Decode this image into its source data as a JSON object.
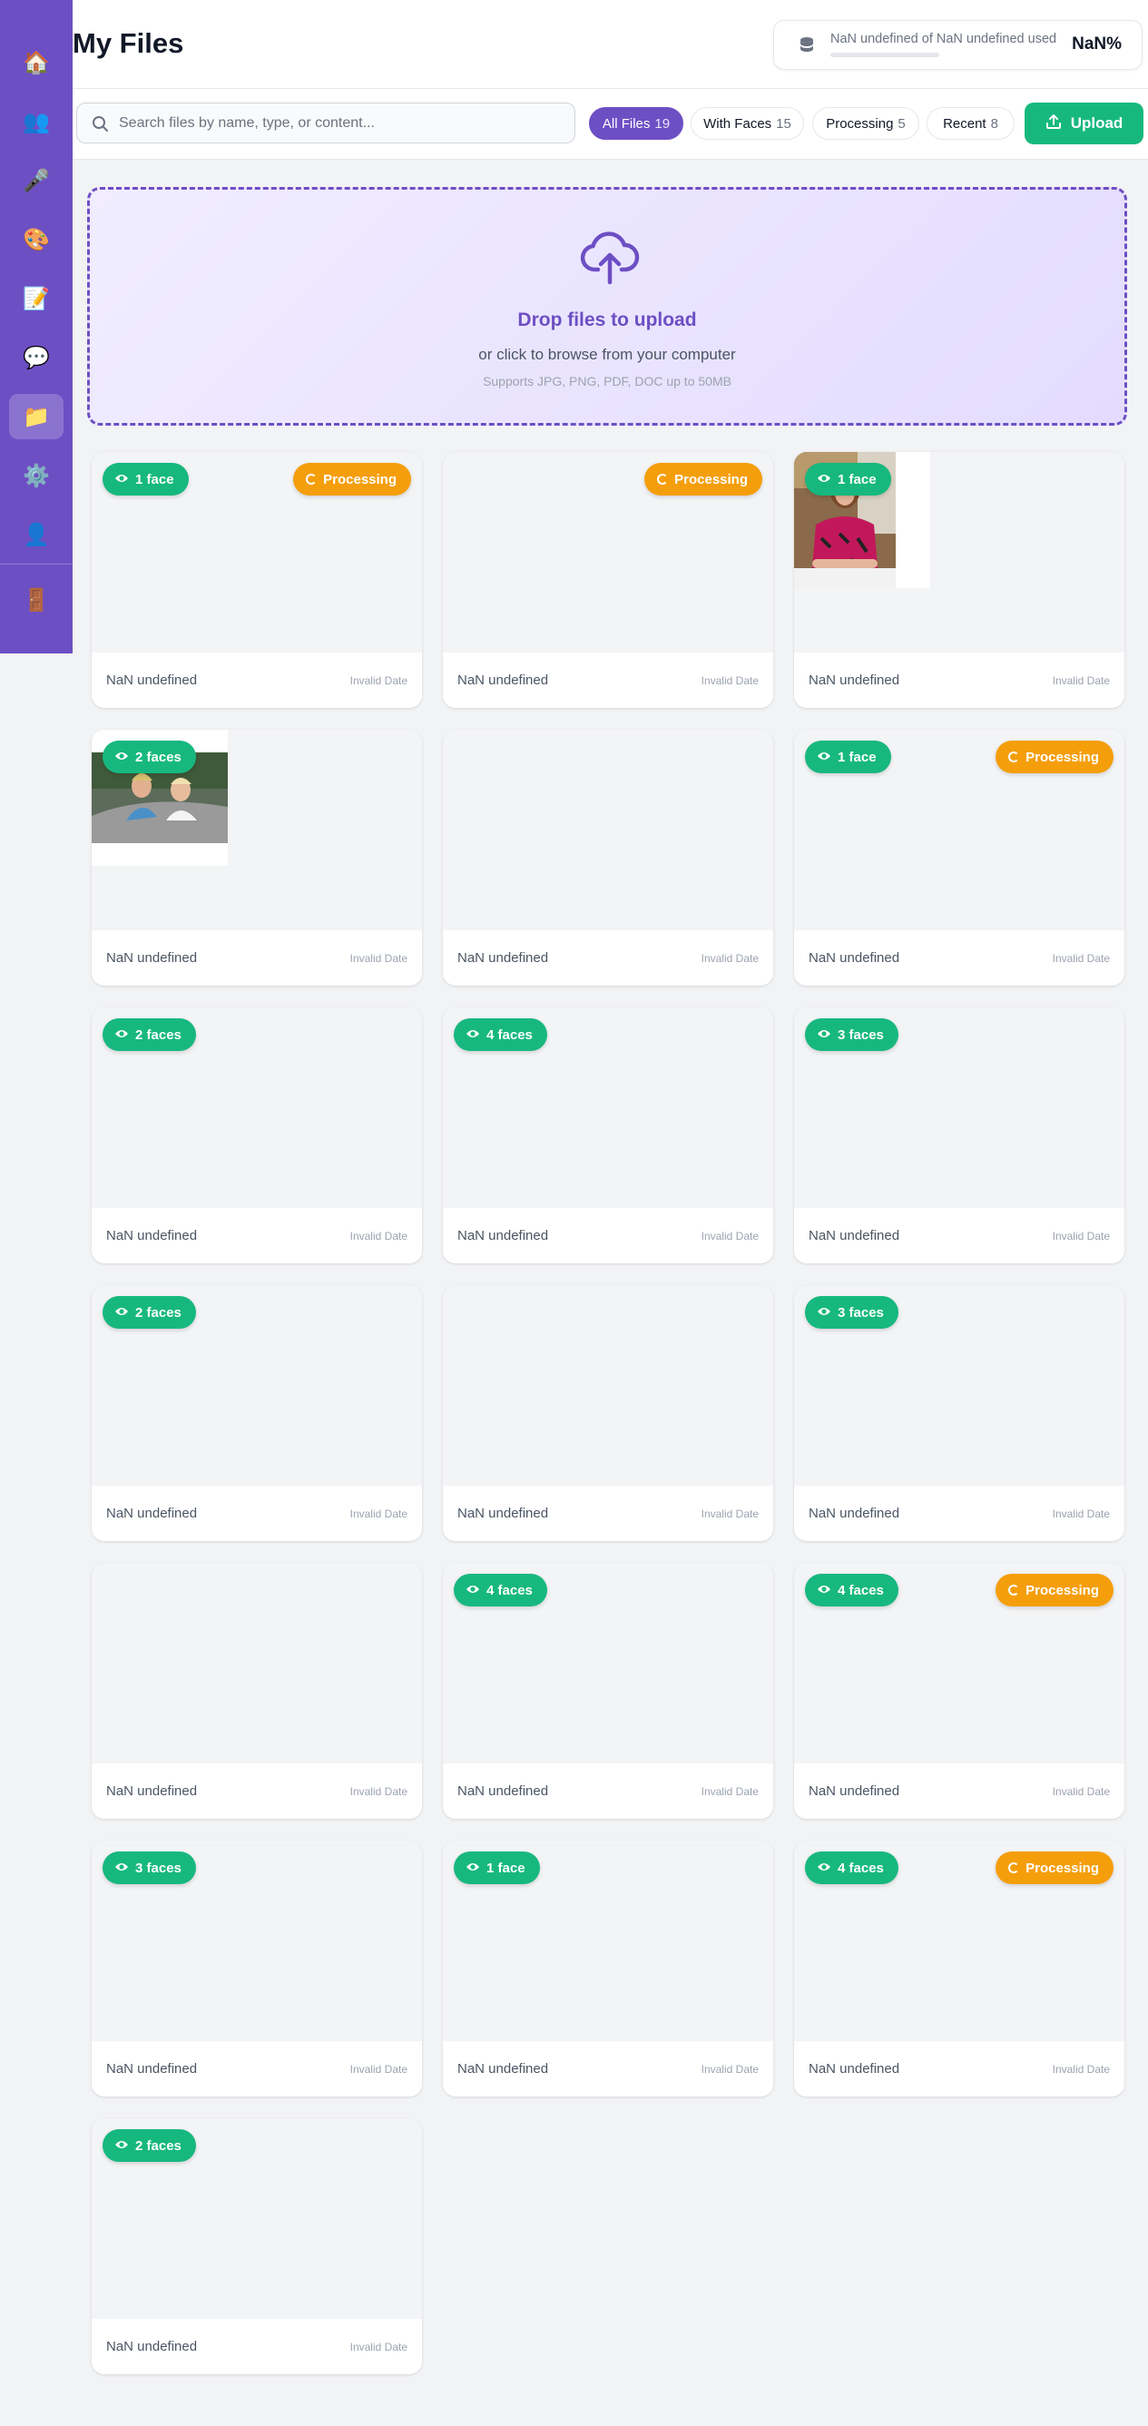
{
  "sidebar": {
    "items": [
      {
        "name": "home",
        "glyph": "🏠",
        "active": false
      },
      {
        "name": "people",
        "glyph": "👥",
        "active": false
      },
      {
        "name": "microphone",
        "glyph": "🎤",
        "active": false
      },
      {
        "name": "palette",
        "glyph": "🎨",
        "active": false
      },
      {
        "name": "notes",
        "glyph": "📝",
        "active": false
      },
      {
        "name": "chat",
        "glyph": "💬",
        "active": false
      },
      {
        "name": "files",
        "glyph": "📁",
        "active": true
      },
      {
        "name": "settings",
        "glyph": "⚙️",
        "active": false
      },
      {
        "name": "profile",
        "glyph": "👤",
        "active": false
      },
      {
        "name": "logout",
        "glyph": "🚪",
        "active": false
      }
    ]
  },
  "header": {
    "title": "My Files",
    "storage_text": "NaN undefined of NaN undefined used",
    "storage_percent": "NaN%"
  },
  "toolbar": {
    "search_placeholder": "Search files by name, type, or content...",
    "filters": [
      {
        "label": "All Files",
        "count": "19",
        "active": true
      },
      {
        "label": "With Faces",
        "count": "15",
        "active": false
      },
      {
        "label": "Processing",
        "count": "5",
        "active": false
      },
      {
        "label": "Recent",
        "count": "8",
        "active": false
      }
    ],
    "upload_label": "Upload"
  },
  "dropzone": {
    "title": "Drop files to upload",
    "subtitle": "or click to browse from your computer",
    "hint": "Supports JPG, PNG, PDF, DOC up to 50MB"
  },
  "colors": {
    "primary": "#6d4fc4",
    "success": "#17b87f",
    "warning": "#f59e0b"
  },
  "files": [
    {
      "faces": "1 face",
      "processing": true,
      "thumb": null,
      "size": "NaN undefined",
      "date": "Invalid Date"
    },
    {
      "faces": null,
      "processing": true,
      "thumb": null,
      "size": "NaN undefined",
      "date": "Invalid Date"
    },
    {
      "faces": "1 face",
      "processing": false,
      "thumb": "woman-portrait",
      "size": "NaN undefined",
      "date": "Invalid Date"
    },
    {
      "faces": "2 faces",
      "processing": false,
      "thumb": "group-outdoor",
      "size": "NaN undefined",
      "date": "Invalid Date"
    },
    {
      "faces": null,
      "processing": false,
      "thumb": null,
      "size": "NaN undefined",
      "date": "Invalid Date"
    },
    {
      "faces": "1 face",
      "processing": true,
      "thumb": null,
      "size": "NaN undefined",
      "date": "Invalid Date"
    },
    {
      "faces": "2 faces",
      "processing": false,
      "thumb": null,
      "size": "NaN undefined",
      "date": "Invalid Date"
    },
    {
      "faces": "4 faces",
      "processing": false,
      "thumb": null,
      "size": "NaN undefined",
      "date": "Invalid Date"
    },
    {
      "faces": "3 faces",
      "processing": false,
      "thumb": null,
      "size": "NaN undefined",
      "date": "Invalid Date"
    },
    {
      "faces": "2 faces",
      "processing": false,
      "thumb": null,
      "size": "NaN undefined",
      "date": "Invalid Date"
    },
    {
      "faces": null,
      "processing": false,
      "thumb": null,
      "size": "NaN undefined",
      "date": "Invalid Date"
    },
    {
      "faces": "3 faces",
      "processing": false,
      "thumb": null,
      "size": "NaN undefined",
      "date": "Invalid Date"
    },
    {
      "faces": null,
      "processing": false,
      "thumb": null,
      "size": "NaN undefined",
      "date": "Invalid Date"
    },
    {
      "faces": "4 faces",
      "processing": false,
      "thumb": null,
      "size": "NaN undefined",
      "date": "Invalid Date"
    },
    {
      "faces": "4 faces",
      "processing": true,
      "thumb": null,
      "size": "NaN undefined",
      "date": "Invalid Date"
    },
    {
      "faces": "3 faces",
      "processing": false,
      "thumb": null,
      "size": "NaN undefined",
      "date": "Invalid Date"
    },
    {
      "faces": "1 face",
      "processing": false,
      "thumb": null,
      "size": "NaN undefined",
      "date": "Invalid Date"
    },
    {
      "faces": "4 faces",
      "processing": true,
      "thumb": null,
      "size": "NaN undefined",
      "date": "Invalid Date"
    },
    {
      "faces": "2 faces",
      "processing": false,
      "thumb": null,
      "size": "NaN undefined",
      "date": "Invalid Date"
    }
  ],
  "labels": {
    "processing": "Processing"
  }
}
